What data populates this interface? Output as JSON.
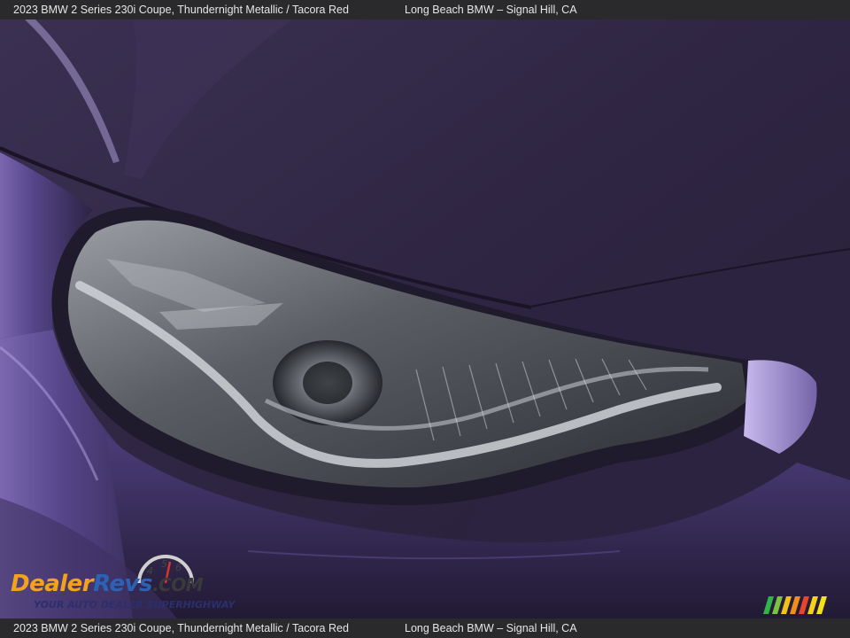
{
  "caption": {
    "vehicle": "2023 BMW 2 Series 230i Coupe,  Thundernight Metallic / Tacora Red",
    "dealer": "Long Beach BMW – Signal Hill, CA"
  },
  "logo": {
    "name": "DealerRevs.com",
    "tagline": "YOUR AUTO DEALER SUPERHIGHWAY",
    "gauge_digits": [
      "4",
      "5",
      "6"
    ]
  },
  "colors": {
    "paint": "#4a3a72",
    "paint_dark": "#241c3a",
    "paint_highlight": "#8f7cc6",
    "lens": "#5c6066",
    "caption_bar": "#2a2a2c",
    "logo_orange": "#f2a21b",
    "logo_blue": "#2b62b6"
  },
  "photo": {
    "subject": "headlight",
    "icons": [
      "headlight-icon",
      "dealer-logo-icon",
      "stripes-icon"
    ]
  }
}
